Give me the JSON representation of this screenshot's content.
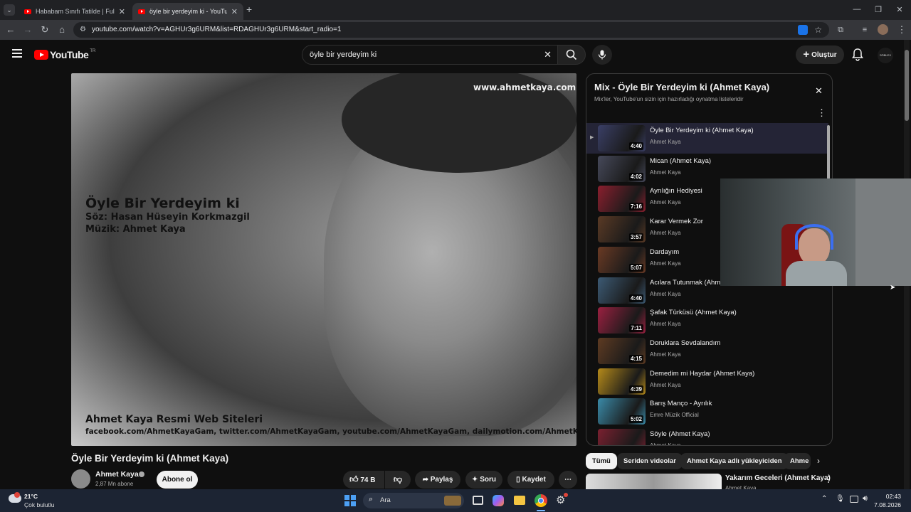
{
  "browser": {
    "tabs": [
      {
        "title": "Hababam Sınıfı Tatilde | Full HD",
        "active": false
      },
      {
        "title": "öyle bir yerdeyim ki - YouTube",
        "active": true
      }
    ],
    "url": "youtube.com/watch?v=AGHUr3g6URM&list=RDAGHUr3g6URM&start_radio=1",
    "new_tab": "+"
  },
  "youtube": {
    "logo": "YouTube",
    "region": "TR",
    "search_value": "öyle bir yerdeyim ki",
    "create_label": "Oluştur",
    "avatar_text": "SÖBLEX"
  },
  "video": {
    "overlay_url": "www.ahmetkaya.com",
    "overlay_title": "Öyle Bir Yerdeyim ki",
    "overlay_lyrics": "Söz: Hasan Hüseyin Korkmazgil",
    "overlay_music": "Müzik: Ahmet Kaya",
    "overlay_site": "Ahmet Kaya Resmi Web Siteleri",
    "overlay_social": "facebook.com/AhmetKayaGam, twitter.com/AhmetKayaGam, youtube.com/AhmetKayaGam, dailymotion.com/AhmetKayaGam",
    "title": "Öyle Bir Yerdeyim ki (Ahmet Kaya)",
    "channel": "Ahmet Kaya",
    "subscribers": "2,87 Mn abone",
    "subscribe_label": "Abone ol",
    "likes": "74 B",
    "share_label": "Paylaş",
    "ask_label": "Soru",
    "save_label": "Kaydet"
  },
  "playlist": {
    "title": "Mix - Öyle Bir Yerdeyim ki (Ahmet Kaya)",
    "subtitle": "Mix'ler, YouTube'un sizin için hazırladığı oynatma listeleridir",
    "items": [
      {
        "title": "Öyle Bir Yerdeyim ki (Ahmet Kaya)",
        "channel": "Ahmet Kaya",
        "duration": "4:40",
        "thumb_color": "#3a3f66"
      },
      {
        "title": "Mican (Ahmet Kaya)",
        "channel": "Ahmet Kaya",
        "duration": "4:02",
        "thumb_color": "#46495a"
      },
      {
        "title": "Ayrılığın Hediyesi",
        "channel": "Ahmet Kaya",
        "duration": "7:16",
        "thumb_color": "#8a1f2e"
      },
      {
        "title": "Karar Vermek Zor",
        "channel": "Ahmet Kaya",
        "duration": "3:57",
        "thumb_color": "#5a3a25"
      },
      {
        "title": "Dardayım",
        "channel": "Ahmet Kaya",
        "duration": "5:07",
        "thumb_color": "#6a3a24"
      },
      {
        "title": "Acılara Tutunmak (Ahm",
        "channel": "Ahmet Kaya",
        "duration": "4:40",
        "thumb_color": "#3c5a74"
      },
      {
        "title": "Şafak Türküsü (Ahmet Kaya)",
        "channel": "Ahmet Kaya",
        "duration": "7:11",
        "thumb_color": "#9a2040"
      },
      {
        "title": "Doruklara Sevdalandım",
        "channel": "Ahmet Kaya",
        "duration": "4:15",
        "thumb_color": "#5e3b22"
      },
      {
        "title": "Demedim mi Haydar (Ahmet Kaya)",
        "channel": "Ahmet Kaya",
        "duration": "4:39",
        "thumb_color": "#b58a1a"
      },
      {
        "title": "Barış Manço - Ayrılık",
        "channel": "Emre Müzik Official",
        "duration": "5:02",
        "thumb_color": "#3a8aa8"
      },
      {
        "title": "Söyle (Ahmet Kaya)",
        "channel": "Ahmet Kaya",
        "duration": "",
        "thumb_color": "#7a2030"
      }
    ]
  },
  "chips": [
    "Tümü",
    "Seriden videolar",
    "Ahmet Kaya adlı yükleyiciden",
    "Ahme"
  ],
  "recommendation": {
    "title": "Yakarım Geceleri (Ahmet Kaya)",
    "channel": "Ahmet Kaya"
  },
  "taskbar": {
    "weather_temp": "21°C",
    "weather_desc": "Çok bulutlu",
    "search_label": "Ara",
    "time": "02:43",
    "date": "7.08.2026"
  },
  "colors": {
    "accent_red": "#ff0000",
    "bg": "#0f0f0f",
    "chip_active_bg": "#f1f1f1"
  }
}
